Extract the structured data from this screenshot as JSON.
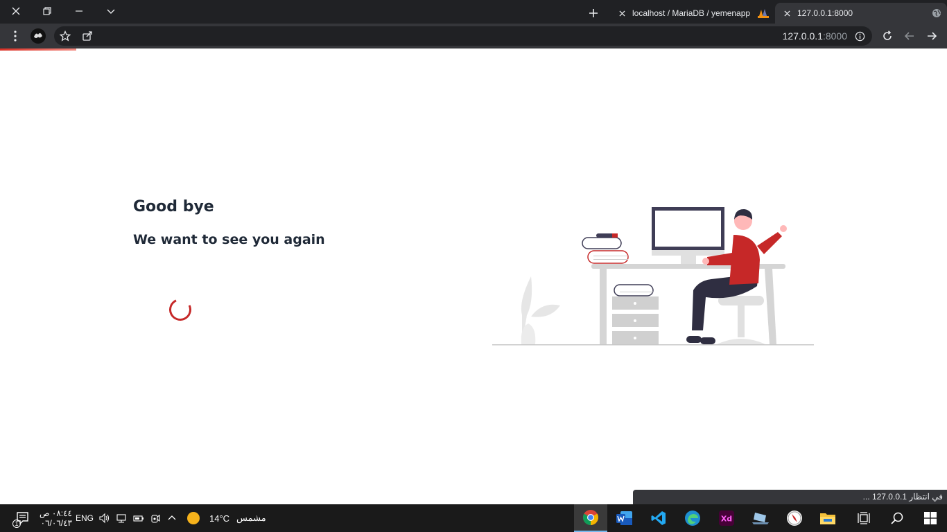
{
  "browser": {
    "tabs": [
      {
        "title": "localhost / MariaDB / yemenapp"
      },
      {
        "title": "127.0.0.1:8000"
      }
    ],
    "url_host": "127.0.0.1",
    "url_port": ":8000"
  },
  "page": {
    "title": "Good bye",
    "subtitle": "We want to see you again"
  },
  "status_bar": {
    "text": "في انتظار 127.0.0.1 ..."
  },
  "taskbar": {
    "time": "٠٨:٤٤ ص",
    "date": "٠٦/٠٦/٤٣",
    "language": "ENG",
    "temperature": "14°C",
    "weather": "مشمس",
    "notification_count": "1",
    "apps": [
      "chrome",
      "word",
      "vscode",
      "edge",
      "xd",
      "virtualbox",
      "compass",
      "file-explorer"
    ]
  },
  "colors": {
    "chrome_dark": "#202124",
    "chrome_mid": "#35363a",
    "accent_red": "#c62828",
    "heading": "#1f2937"
  }
}
